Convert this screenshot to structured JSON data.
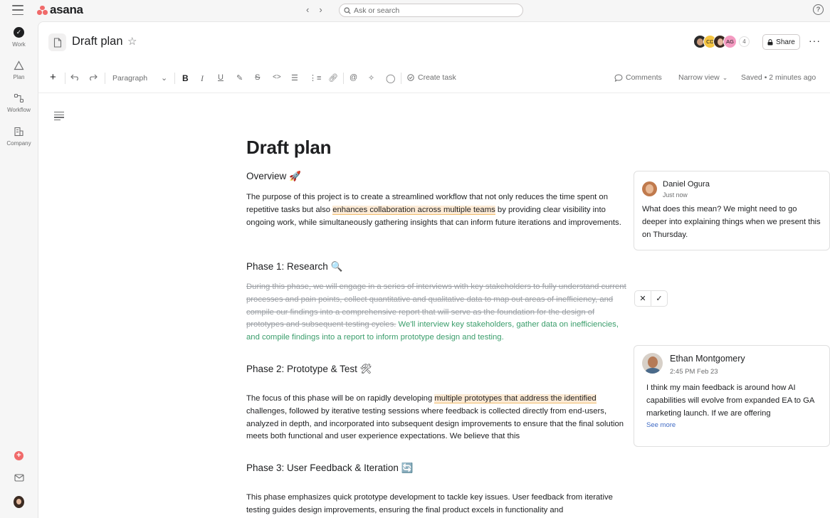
{
  "app": {
    "brand": "asana",
    "brand_color": "#f06a6a"
  },
  "topbar": {
    "back_icon": "chevron-left-icon",
    "forward_icon": "chevron-right-icon",
    "search_placeholder": "Ask or search",
    "help_label": "?"
  },
  "rail": {
    "items": [
      {
        "label": "Work",
        "icon": "check-circle-icon"
      },
      {
        "label": "Plan",
        "icon": "triangle-icon"
      },
      {
        "label": "Workflow",
        "icon": "workflow-icon"
      },
      {
        "label": "Company",
        "icon": "building-icon"
      }
    ]
  },
  "header": {
    "title": "Draft plan",
    "avatars": [
      {
        "initials": "",
        "color": "#2b2b2b"
      },
      {
        "initials": "CD",
        "color": "#f5c542"
      },
      {
        "initials": "",
        "color": "#3a2a22"
      },
      {
        "initials": "AG",
        "color": "#f49ac1"
      }
    ],
    "member_count": "4",
    "share_label": "Share"
  },
  "toolbar": {
    "paragraph_label": "Paragraph",
    "create_task_label": "Create task",
    "comments_label": "Comments",
    "view_label": "Narrow view",
    "saved_label": "Saved • 2 minutes ago"
  },
  "doc": {
    "title": "Draft plan",
    "overview": {
      "heading": "Overview 🚀",
      "text_before": "The purpose of this project is to create a streamlined workflow that not only reduces the time spent on repetitive tasks but also ",
      "highlight": "enhances collaboration across multiple teams",
      "text_after": " by providing clear visibility into ongoing work, while simultaneously gathering insights that can inform future iterations and improvements."
    },
    "phase1": {
      "heading": "Phase 1: Research 🔍",
      "struck": "During this phase, we will engage in a series of interviews with key stakeholders to fully understand current processes and pain points, collect quantitative and qualitative data to map out areas of inefficiency, and compile our findings into a comprehensive report that will serve as the foundation for the design of prototypes and subsequent testing cycles.",
      "suggested": " We'll interview key stakeholders, gather data on inefficiencies, and compile findings into a report to inform prototype design and testing."
    },
    "phase2": {
      "heading": "Phase 2: Prototype & Test 🛠",
      "text_before": "The focus of this phase will be on rapidly developing ",
      "highlight": "multiple prototypes that address the identified",
      "text_after": " challenges, followed by iterative testing sessions where feedback is collected directly from end-users, analyzed in depth, and incorporated into subsequent design improvements to ensure that the final solution meets both functional and user experience expectations. We believe that this"
    },
    "phase3": {
      "heading": "Phase 3: User Feedback & Iteration 🔄",
      "text": "This phase emphasizes quick prototype development to tackle key issues. User feedback from iterative testing guides design improvements, ensuring the final product excels in functionality and"
    }
  },
  "comments": [
    {
      "author": "Daniel Ogura",
      "time": "Just now",
      "text": "What does this mean? We might need to go deeper into explaining things when we present this on Thursday."
    },
    {
      "author": "Ethan Montgomery",
      "time": "2:45 PM Feb 23",
      "text": "I think my main feedback is around how AI capabilities will evolve from expanded EA to GA marketing launch. If we are offering",
      "see_more": "See more"
    }
  ],
  "suggestion_actions": {
    "reject": "✕",
    "accept": "✓"
  }
}
